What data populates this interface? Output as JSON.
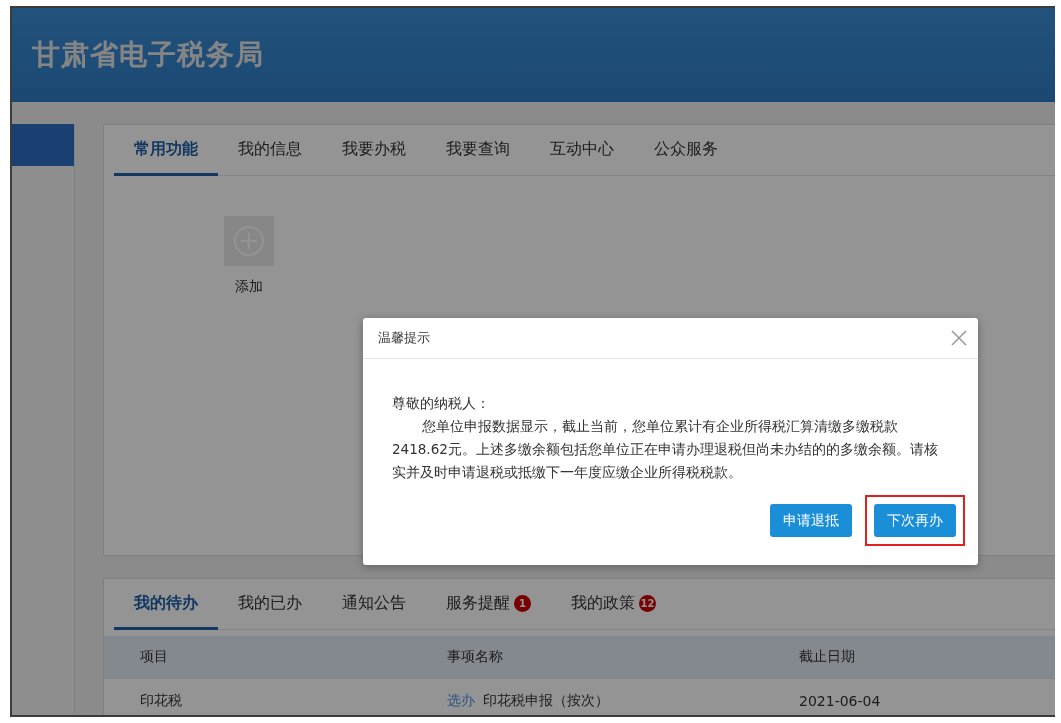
{
  "header": {
    "title": "甘肃省电子税务局"
  },
  "top_tabs": [
    {
      "label": "常用功能",
      "selected": true
    },
    {
      "label": "我的信息",
      "selected": false
    },
    {
      "label": "我要办税",
      "selected": false
    },
    {
      "label": "我要查询",
      "selected": false
    },
    {
      "label": "互动中心",
      "selected": false
    },
    {
      "label": "公众服务",
      "selected": false
    }
  ],
  "add_tile": {
    "label": "添加"
  },
  "bottom_tabs": [
    {
      "label": "我的待办",
      "selected": true
    },
    {
      "label": "我的已办",
      "selected": false
    },
    {
      "label": "通知公告",
      "selected": false
    },
    {
      "label": "服务提醒",
      "selected": false,
      "badge": "1"
    },
    {
      "label": "我的政策",
      "selected": false,
      "badge": "12"
    }
  ],
  "table": {
    "columns": [
      "项目",
      "事项名称",
      "截止日期"
    ],
    "rows": [
      {
        "item": "印花税",
        "action": "选办",
        "name": "印花税申报（按次）",
        "deadline": "2021-06-04"
      }
    ]
  },
  "dialog": {
    "title": "温馨提示",
    "greeting": "尊敬的纳税人：",
    "body": "您单位申报数据显示，截止当前，您单位累计有企业所得税汇算清缴多缴税款2418.62元。上述多缴余额包括您单位正在申请办理退税但尚未办结的的多缴余额。请核实并及时申请退税或抵缴下一年度应缴企业所得税税款。",
    "buttons": [
      {
        "label": "申请退抵",
        "highlighted": false
      },
      {
        "label": "下次再办",
        "highlighted": true
      }
    ]
  }
}
